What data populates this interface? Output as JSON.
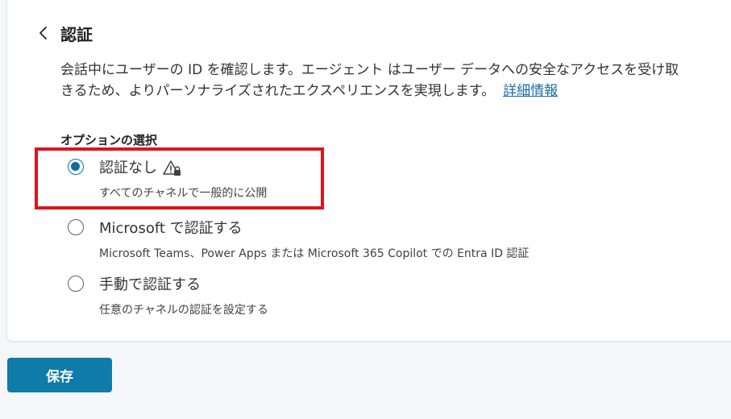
{
  "header": {
    "back_icon": "chevron-left-icon",
    "title": "認証"
  },
  "description": {
    "line1": "会話中にユーザーの ID を確認します。エージェント はユーザー データへの安全なアクセスを受け取",
    "line2": "きるため、よりパーソナライズされたエクスペリエンスを実現します。",
    "link": "詳細情報"
  },
  "options": {
    "heading": "オプションの選択",
    "items": [
      {
        "label": "認証なし",
        "description": "すべてのチャネルで一般的に公開",
        "selected": true,
        "icon": "warning-lock-icon"
      },
      {
        "label": "Microsoft で認証する",
        "description": "Microsoft Teams、Power Apps または Microsoft 365 Copilot での Entra ID 認証",
        "selected": false
      },
      {
        "label": "手動で認証する",
        "description": "任意のチャネルの認証を設定する",
        "selected": false
      }
    ]
  },
  "save_label": "保存",
  "colors": {
    "accent": "#0f7ba8",
    "highlight": "#e0131a",
    "link": "#1a6ea8"
  }
}
